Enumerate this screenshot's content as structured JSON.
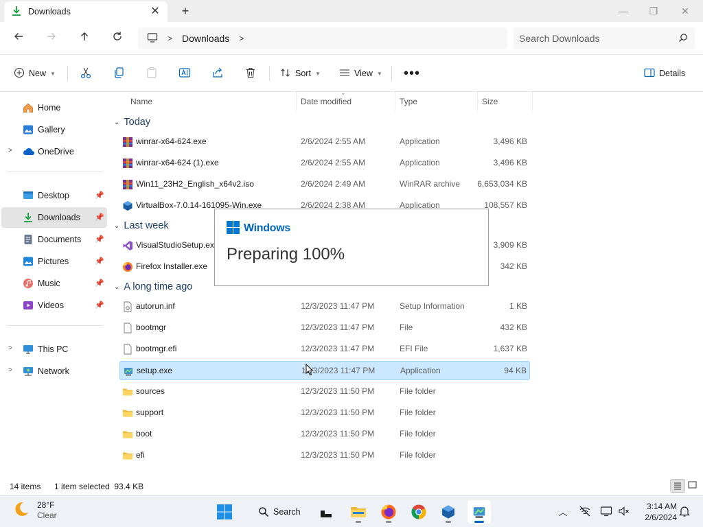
{
  "tab": {
    "title": "Downloads"
  },
  "address": {
    "crumbs": [
      "Downloads"
    ]
  },
  "search": {
    "placeholder": "Search Downloads"
  },
  "commands": {
    "new_label": "New",
    "sort_label": "Sort",
    "view_label": "View",
    "details_label": "Details"
  },
  "sidebar": {
    "items": [
      {
        "label": "Home"
      },
      {
        "label": "Gallery"
      },
      {
        "label": "OneDrive"
      },
      {
        "label": "Desktop"
      },
      {
        "label": "Downloads"
      },
      {
        "label": "Documents"
      },
      {
        "label": "Pictures"
      },
      {
        "label": "Music"
      },
      {
        "label": "Videos"
      },
      {
        "label": "This PC"
      },
      {
        "label": "Network"
      }
    ]
  },
  "columns": {
    "name": "Name",
    "date": "Date modified",
    "type": "Type",
    "size": "Size"
  },
  "groups": {
    "today": "Today",
    "last_week": "Last week",
    "long_ago": "A long time ago"
  },
  "files": [
    {
      "name": "winrar-x64-624.exe",
      "date": "2/6/2024 2:55 AM",
      "type": "Application",
      "size": "3,496 KB"
    },
    {
      "name": "winrar-x64-624 (1).exe",
      "date": "2/6/2024 2:55 AM",
      "type": "Application",
      "size": "3,496 KB"
    },
    {
      "name": "Win11_23H2_English_x64v2.iso",
      "date": "2/6/2024 2:49 AM",
      "type": "WinRAR archive",
      "size": "6,653,034 KB"
    },
    {
      "name": "VirtualBox-7.0.14-161095-Win.exe",
      "date": "2/6/2024 2:38 AM",
      "type": "Application",
      "size": "108,557 KB"
    },
    {
      "name": "VisualStudioSetup.exe",
      "date": "",
      "type": "",
      "size": "3,909 KB"
    },
    {
      "name": "Firefox Installer.exe",
      "date": "",
      "type": "",
      "size": "342 KB"
    },
    {
      "name": "autorun.inf",
      "date": "12/3/2023 11:47 PM",
      "type": "Setup Information",
      "size": "1 KB"
    },
    {
      "name": "bootmgr",
      "date": "12/3/2023 11:47 PM",
      "type": "File",
      "size": "432 KB"
    },
    {
      "name": "bootmgr.efi",
      "date": "12/3/2023 11:47 PM",
      "type": "EFI File",
      "size": "1,637 KB"
    },
    {
      "name": "setup.exe",
      "date": "12/3/2023 11:47 PM",
      "type": "Application",
      "size": "94 KB"
    },
    {
      "name": "sources",
      "date": "12/3/2023 11:50 PM",
      "type": "File folder",
      "size": ""
    },
    {
      "name": "support",
      "date": "12/3/2023 11:50 PM",
      "type": "File folder",
      "size": ""
    },
    {
      "name": "boot",
      "date": "12/3/2023 11:50 PM",
      "type": "File folder",
      "size": ""
    },
    {
      "name": "efi",
      "date": "12/3/2023 11:50 PM",
      "type": "File folder",
      "size": ""
    }
  ],
  "popup": {
    "brand": "Windows",
    "message": "Preparing 100%"
  },
  "status": {
    "count": "14 items",
    "selection": "1 item selected  93.4 KB"
  },
  "taskbar": {
    "weather_temp": "28°F",
    "weather_cond": "Clear",
    "search_label": "Search",
    "time": "3:14 AM",
    "date": "2/6/2024"
  },
  "colors": {
    "accent": "#0067c0",
    "selection": "#cce8ff",
    "folder": "#f5c342"
  }
}
